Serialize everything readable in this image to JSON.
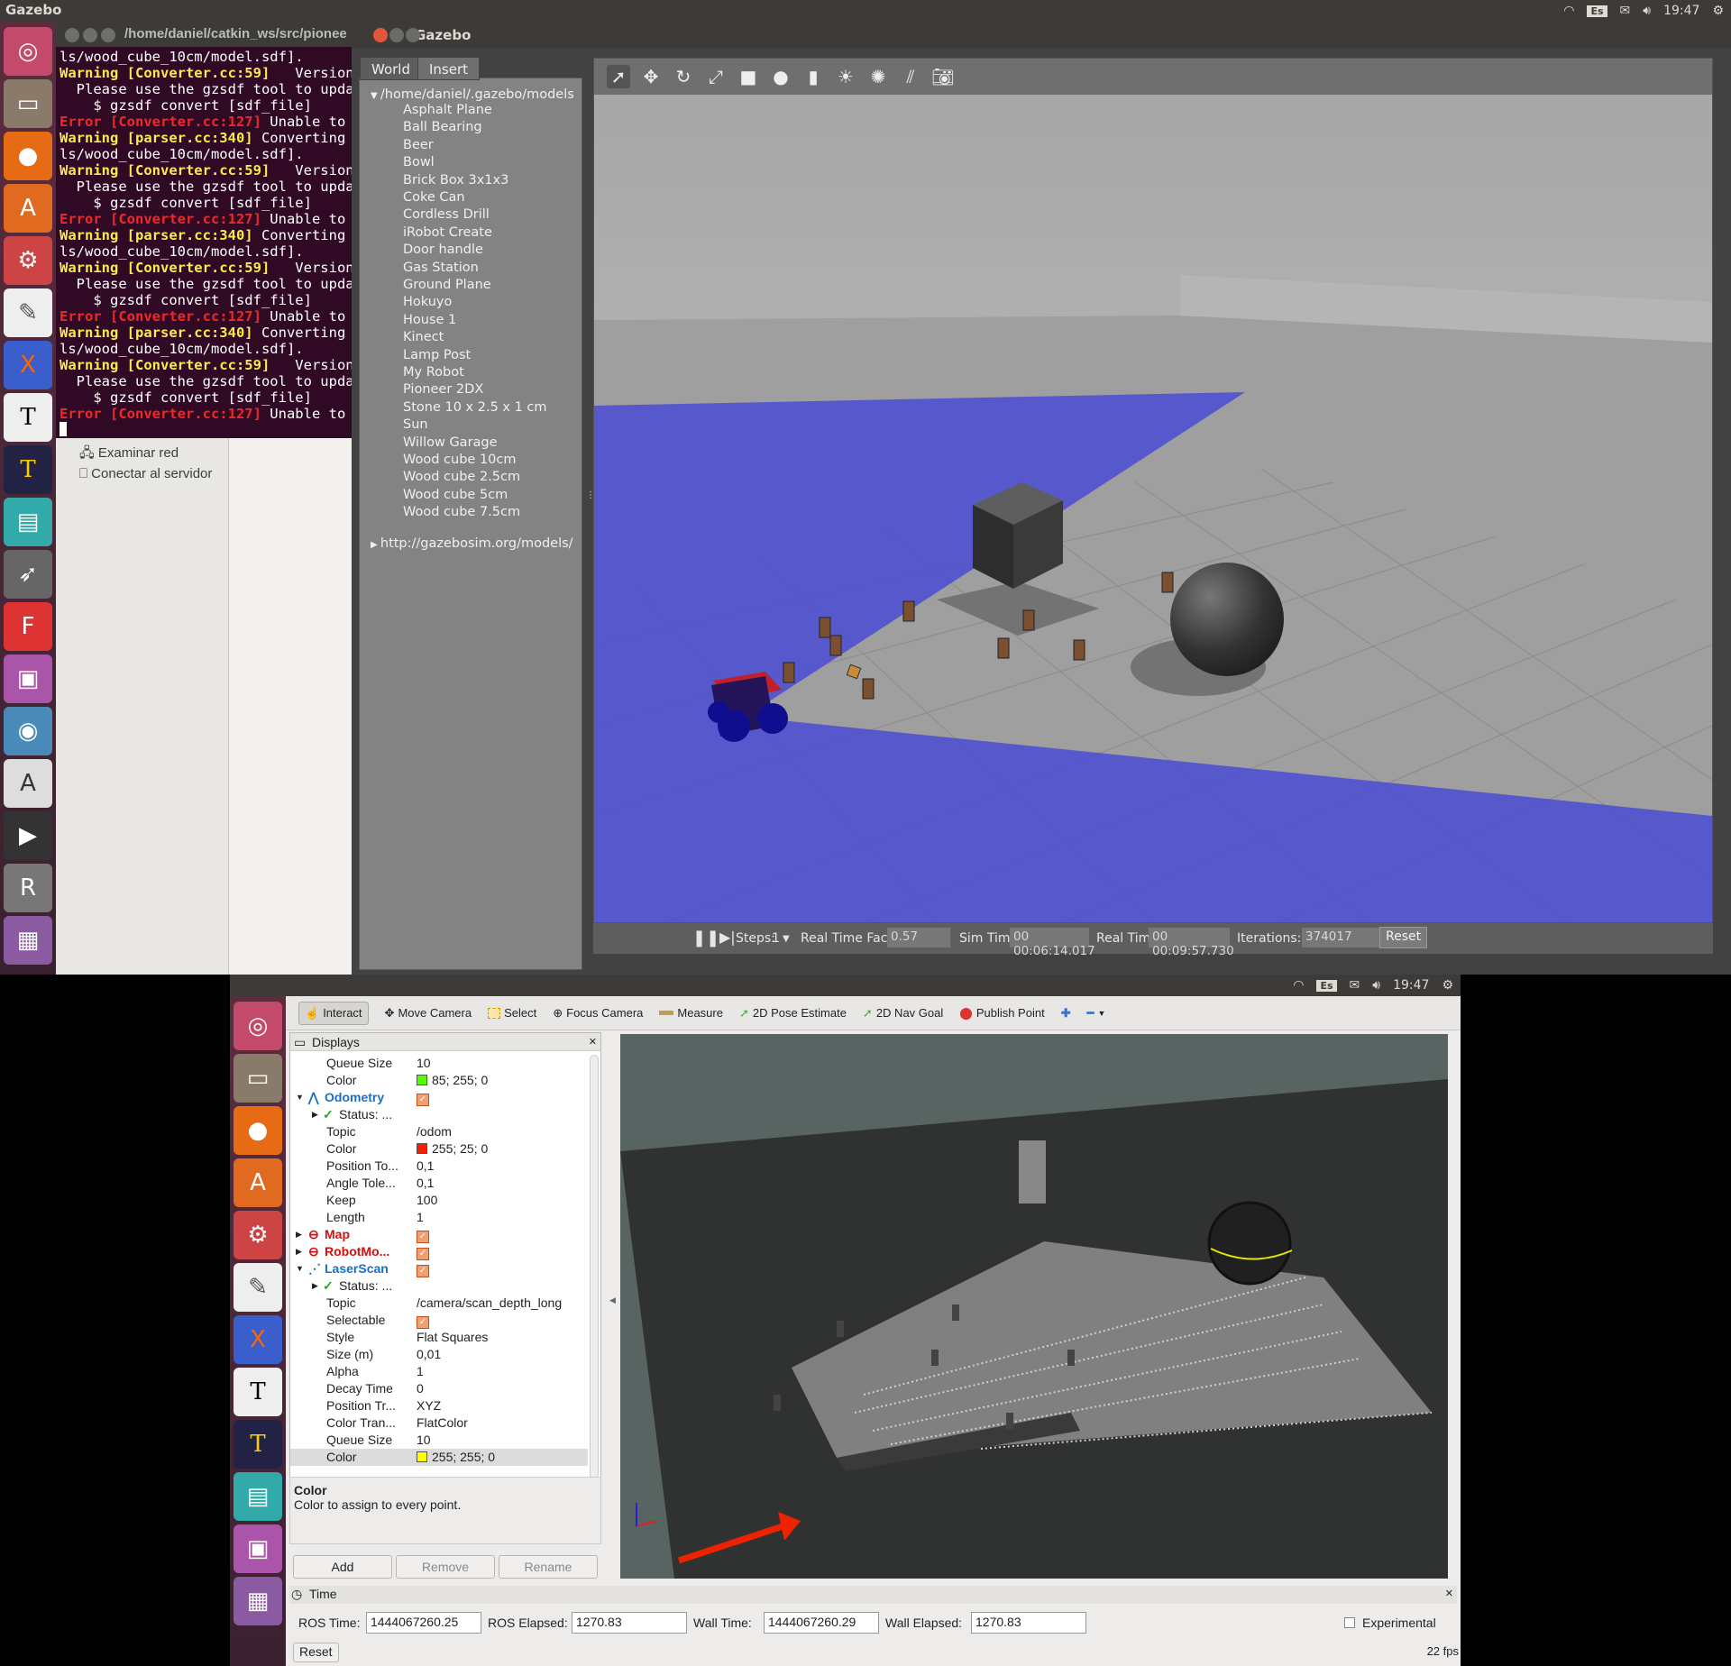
{
  "top_panel": {
    "app": "Gazebo",
    "lang": "Es",
    "time": "19:47"
  },
  "terminal": {
    "title": "/home/daniel/catkin_ws/src/pionee",
    "lines": [
      [
        {
          "t": "ls/wood_cube_10cm/model.sdf].",
          "c": ""
        }
      ],
      [
        {
          "t": "Warning [Converter.cc:59]",
          "c": "warn"
        },
        {
          "t": "   Version[",
          "c": ""
        }
      ],
      [
        {
          "t": "  Please use the gzsdf tool to updat",
          "c": ""
        }
      ],
      [
        {
          "t": "    $ gzsdf convert [sdf_file]",
          "c": ""
        }
      ],
      [
        {
          "t": "Error [Converter.cc:127]",
          "c": "err"
        },
        {
          "t": " Unable to c",
          "c": ""
        }
      ],
      [
        {
          "t": "Warning [parser.cc:340]",
          "c": "warn"
        },
        {
          "t": " Converting a",
          "c": ""
        }
      ],
      [
        {
          "t": "ls/wood_cube_10cm/model.sdf].",
          "c": ""
        }
      ],
      [
        {
          "t": "Warning [Converter.cc:59]",
          "c": "warn"
        },
        {
          "t": "   Version[",
          "c": ""
        }
      ],
      [
        {
          "t": "  Please use the gzsdf tool to updat",
          "c": ""
        }
      ],
      [
        {
          "t": "    $ gzsdf convert [sdf_file]",
          "c": ""
        }
      ],
      [
        {
          "t": "Error [Converter.cc:127]",
          "c": "err"
        },
        {
          "t": " Unable to c",
          "c": ""
        }
      ],
      [
        {
          "t": "Warning [parser.cc:340]",
          "c": "warn"
        },
        {
          "t": " Converting a",
          "c": ""
        }
      ],
      [
        {
          "t": "ls/wood_cube_10cm/model.sdf].",
          "c": ""
        }
      ],
      [
        {
          "t": "Warning [Converter.cc:59]",
          "c": "warn"
        },
        {
          "t": "   Version[",
          "c": ""
        }
      ],
      [
        {
          "t": "  Please use the gzsdf tool to updat",
          "c": ""
        }
      ],
      [
        {
          "t": "    $ gzsdf convert [sdf_file]",
          "c": ""
        }
      ],
      [
        {
          "t": "Error [Converter.cc:127]",
          "c": "err"
        },
        {
          "t": " Unable to c",
          "c": ""
        }
      ],
      [
        {
          "t": "Warning [parser.cc:340]",
          "c": "warn"
        },
        {
          "t": " Converting a",
          "c": ""
        }
      ],
      [
        {
          "t": "ls/wood_cube_10cm/model.sdf].",
          "c": ""
        }
      ],
      [
        {
          "t": "Warning [Converter.cc:59]",
          "c": "warn"
        },
        {
          "t": "   Version[",
          "c": ""
        }
      ],
      [
        {
          "t": "  Please use the gzsdf tool to updat",
          "c": ""
        }
      ],
      [
        {
          "t": "    $ gzsdf convert [sdf_file]",
          "c": ""
        }
      ],
      [
        {
          "t": "Error [Converter.cc:127]",
          "c": "err"
        },
        {
          "t": " Unable to c",
          "c": ""
        }
      ]
    ]
  },
  "nautilus": {
    "browse_network": "Examinar red",
    "connect_server": "Conectar al servidor"
  },
  "gazebo": {
    "title": "Gazebo",
    "tabs": [
      "World",
      "Insert"
    ],
    "tree_root": "/home/daniel/.gazebo/models",
    "models": [
      "Asphalt Plane",
      "Ball Bearing",
      "Beer",
      "Bowl",
      "Brick Box 3x1x3",
      "Coke Can",
      "Cordless Drill",
      "iRobot Create",
      "Door handle",
      "Gas Station",
      "Ground Plane",
      "Hokuyo",
      "House 1",
      "Kinect",
      "Lamp Post",
      "My Robot",
      "Pioneer 2DX",
      "Stone 10 x 2.5 x 1 cm",
      "Sun",
      "Willow Garage",
      "Wood cube 10cm",
      "Wood cube 2.5cm",
      "Wood cube 5cm",
      "Wood cube 7.5cm"
    ],
    "tree_remote": "http://gazebosim.org/models/",
    "bottom": {
      "steps_label": "Steps:",
      "steps": "1",
      "rtf_label": "Real Time Factor:",
      "rtf": "0.57",
      "sim_label": "Sim Time:",
      "sim": "00 00:06:14.017",
      "real_label": "Real Time:",
      "real": "00 00:09:57.730",
      "iter_label": "Iterations:",
      "iter": "374017",
      "reset": "Reset"
    }
  },
  "rviz_panel": {
    "lang": "Es",
    "time": "19:47"
  },
  "rviz": {
    "tools": [
      "Interact",
      "Move Camera",
      "Select",
      "Focus Camera",
      "Measure",
      "2D Pose Estimate",
      "2D Nav Goal",
      "Publish Point"
    ],
    "displays_title": "Displays",
    "rows": [
      {
        "k": "Queue Size",
        "v": "10",
        "type": "prop"
      },
      {
        "k": "Color",
        "v": "85; 255; 0",
        "type": "color",
        "sw": "#55ff00"
      },
      {
        "k": "Odometry",
        "type": "display",
        "color": "#1a6fc4",
        "icon": "odom"
      },
      {
        "k": "Status: ...",
        "type": "status"
      },
      {
        "k": "Topic",
        "v": "/odom",
        "type": "prop"
      },
      {
        "k": "Color",
        "v": "255; 25; 0",
        "type": "color",
        "sw": "#ff1900"
      },
      {
        "k": "Position To...",
        "v": "0,1",
        "type": "prop"
      },
      {
        "k": "Angle Tole...",
        "v": "0,1",
        "type": "prop"
      },
      {
        "k": "Keep",
        "v": "100",
        "type": "prop"
      },
      {
        "k": "Length",
        "v": "1",
        "type": "prop"
      },
      {
        "k": "Map",
        "type": "display",
        "color": "#d01010",
        "icon": "err"
      },
      {
        "k": "RobotMo...",
        "type": "display",
        "color": "#d01010",
        "icon": "err"
      },
      {
        "k": "LaserScan",
        "type": "display",
        "color": "#1a6fc4",
        "icon": "laser"
      },
      {
        "k": "Status: ...",
        "type": "status"
      },
      {
        "k": "Topic",
        "v": "/camera/scan_depth_long",
        "type": "prop"
      },
      {
        "k": "Selectable",
        "v": "",
        "type": "check"
      },
      {
        "k": "Style",
        "v": "Flat Squares",
        "type": "prop"
      },
      {
        "k": "Size (m)",
        "v": "0,01",
        "type": "prop"
      },
      {
        "k": "Alpha",
        "v": "1",
        "type": "prop"
      },
      {
        "k": "Decay Time",
        "v": "0",
        "type": "prop"
      },
      {
        "k": "Position Tr...",
        "v": "XYZ",
        "type": "prop"
      },
      {
        "k": "Color Tran...",
        "v": "FlatColor",
        "type": "prop"
      },
      {
        "k": "Queue Size",
        "v": "10",
        "type": "prop"
      },
      {
        "k": "Color",
        "v": "255; 255; 0",
        "type": "color",
        "sw": "#ffff00",
        "selected": true
      }
    ],
    "desc_title": "Color",
    "desc_text": "Color to assign to every point.",
    "buttons": {
      "add": "Add",
      "remove": "Remove",
      "rename": "Rename"
    },
    "time": {
      "title": "Time",
      "ros_time_label": "ROS Time:",
      "ros_time": "1444067260.25",
      "ros_elapsed_label": "ROS Elapsed:",
      "ros_elapsed": "1270.83",
      "wall_time_label": "Wall Time:",
      "wall_time": "1444067260.29",
      "wall_elapsed_label": "Wall Elapsed:",
      "wall_elapsed": "1270.83",
      "experimental": "Experimental",
      "reset": "Reset",
      "fps": "22 fps"
    }
  }
}
